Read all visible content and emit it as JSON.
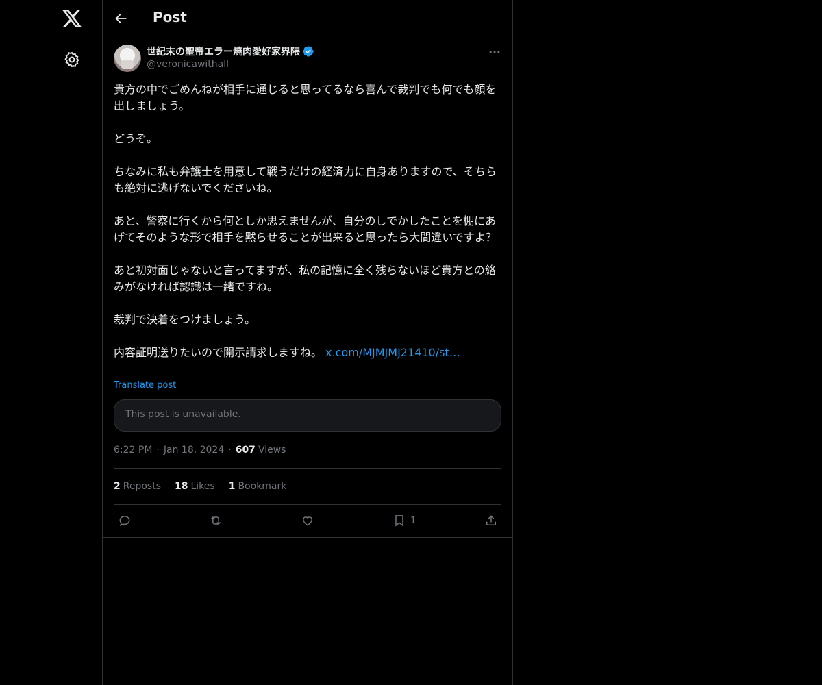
{
  "icons": {
    "logo": "x-logo-icon",
    "settings": "gear-icon",
    "back": "arrow-left-icon",
    "more": "more-horizontal-icon",
    "verified": "verified-badge-icon",
    "reply": "reply-icon",
    "repost": "repost-icon",
    "like": "heart-icon",
    "bookmark": "bookmark-icon",
    "share": "share-icon"
  },
  "colors": {
    "background": "#000000",
    "text": "#e7e9ea",
    "muted": "#71767b",
    "accent": "#1d9bf0",
    "border": "#2f3336"
  },
  "header": {
    "title": "Post"
  },
  "author": {
    "display_name": "世紀末の聖帝エラー焼肉愛好家界隈",
    "handle": "@veronicawithall",
    "verified": true
  },
  "post": {
    "paragraphs": [
      "貴方の中でごめんねが相手に通じると思ってるなら喜んで裁判でも何でも顔を出しましょう。",
      "どうぞ。",
      "ちなみに私も弁護士を用意して戦うだけの経済力に自身ありますので、そちらも絶対に逃げないでくださいね。",
      "あと、警察に行くから何としか思えませんが、自分のしでかしたことを棚にあげてそのような形で相手を黙らせることが出来ると思ったら大間違いですよ？",
      "あと初対面じゃないと言ってますが、私の記憶に全く残らないほど貴方との絡みがなければ認識は一緒ですね。",
      "裁判で決着をつけましょう。"
    ],
    "last_text": "内容証明送りたいので開示請求しますね。",
    "link_text": "x.com/MJMJMJ21410/st…",
    "translate_label": "Translate post",
    "quote_unavailable": "This post is unavailable.",
    "time": "6:22 PM",
    "date": "Jan 18, 2024",
    "views_count": "607",
    "views_label": "Views"
  },
  "stats": {
    "reposts_count": "2",
    "reposts_label": "Reposts",
    "likes_count": "18",
    "likes_label": "Likes",
    "bookmarks_count": "1",
    "bookmarks_label": "Bookmark"
  },
  "actions": {
    "bookmark_count": "1"
  }
}
